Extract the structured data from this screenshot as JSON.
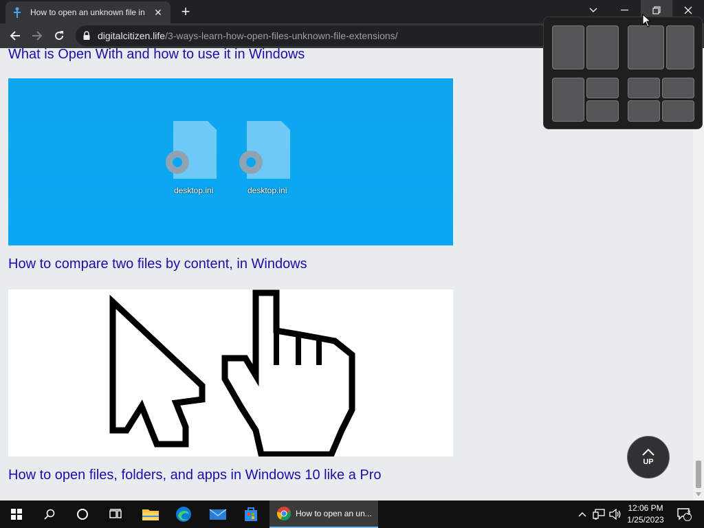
{
  "browser": {
    "tab_title": "How to open an unknown file in",
    "domain": "digitalcitizen.life",
    "path": "/3-ways-learn-how-open-files-unknown-file-extensions/"
  },
  "page": {
    "links": [
      "What is Open With and how to use it in Windows",
      "How to compare two files by content, in Windows",
      "How to open files, folders, and apps in Windows 10 like a Pro"
    ],
    "desktop_files": [
      "desktop.ini",
      "desktop.ini"
    ],
    "up_label": "UP"
  },
  "taskbar": {
    "active_app": "How to open an un...",
    "time": "12:06 PM",
    "date": "1/25/2023",
    "notifications": "3"
  },
  "colors": {
    "link": "#1a0dab",
    "thumb_blue": "#0aa8f4"
  }
}
